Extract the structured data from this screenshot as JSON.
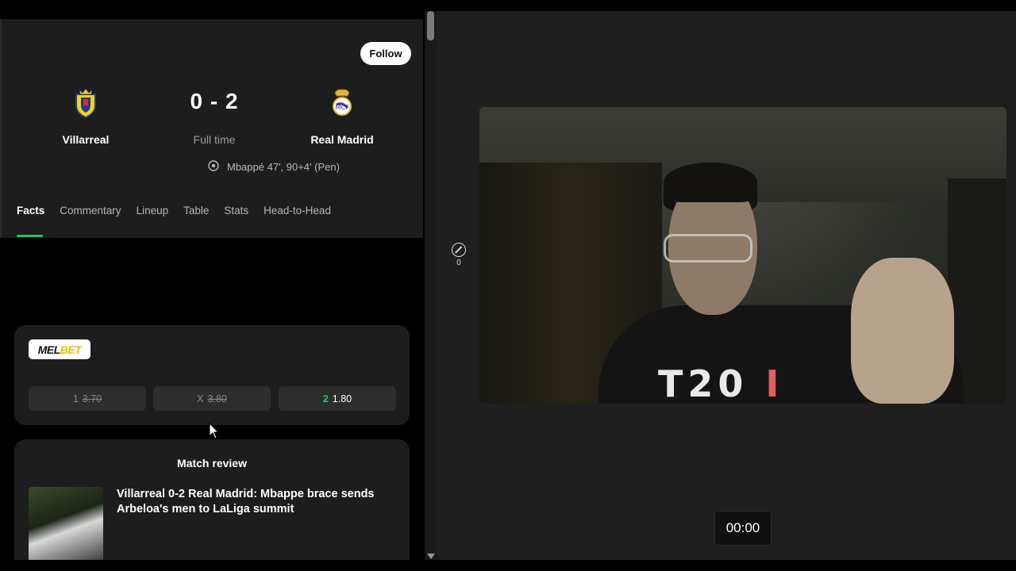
{
  "match": {
    "follow_label": "Follow",
    "home_team": "Villarreal",
    "away_team": "Real Madrid",
    "score": "0 - 2",
    "status": "Full time",
    "scorer_line": "Mbappé 47', 90+4' (Pen)"
  },
  "tabs": [
    {
      "label": "Facts",
      "active": true
    },
    {
      "label": "Commentary"
    },
    {
      "label": "Lineup"
    },
    {
      "label": "Table"
    },
    {
      "label": "Stats"
    },
    {
      "label": "Head-to-Head"
    }
  ],
  "odds": {
    "brand_part1": "MEL",
    "brand_part2": "BET",
    "home": {
      "label": "1",
      "value": "3.70"
    },
    "draw": {
      "label": "X",
      "value": "3.80"
    },
    "away": {
      "label": "2",
      "value": "1.80"
    }
  },
  "review": {
    "title": "Match review",
    "headline": "Villarreal 0-2 Real Madrid: Mbappe brace sends Arbeloa's men to LaLiga summit"
  },
  "camera": {
    "side_count": "0",
    "shirt_text_1": "T2",
    "shirt_text_2": "0",
    "shirt_text_3": "I",
    "timer": "00:00"
  },
  "colors": {
    "accent_green": "#22c55e",
    "card_bg": "#1d1d1d",
    "melbet_yellow": "#f5b800"
  },
  "icons": {
    "home_badge": "villarreal-crest-icon",
    "away_badge": "real-madrid-crest-icon",
    "goal": "football-icon"
  }
}
